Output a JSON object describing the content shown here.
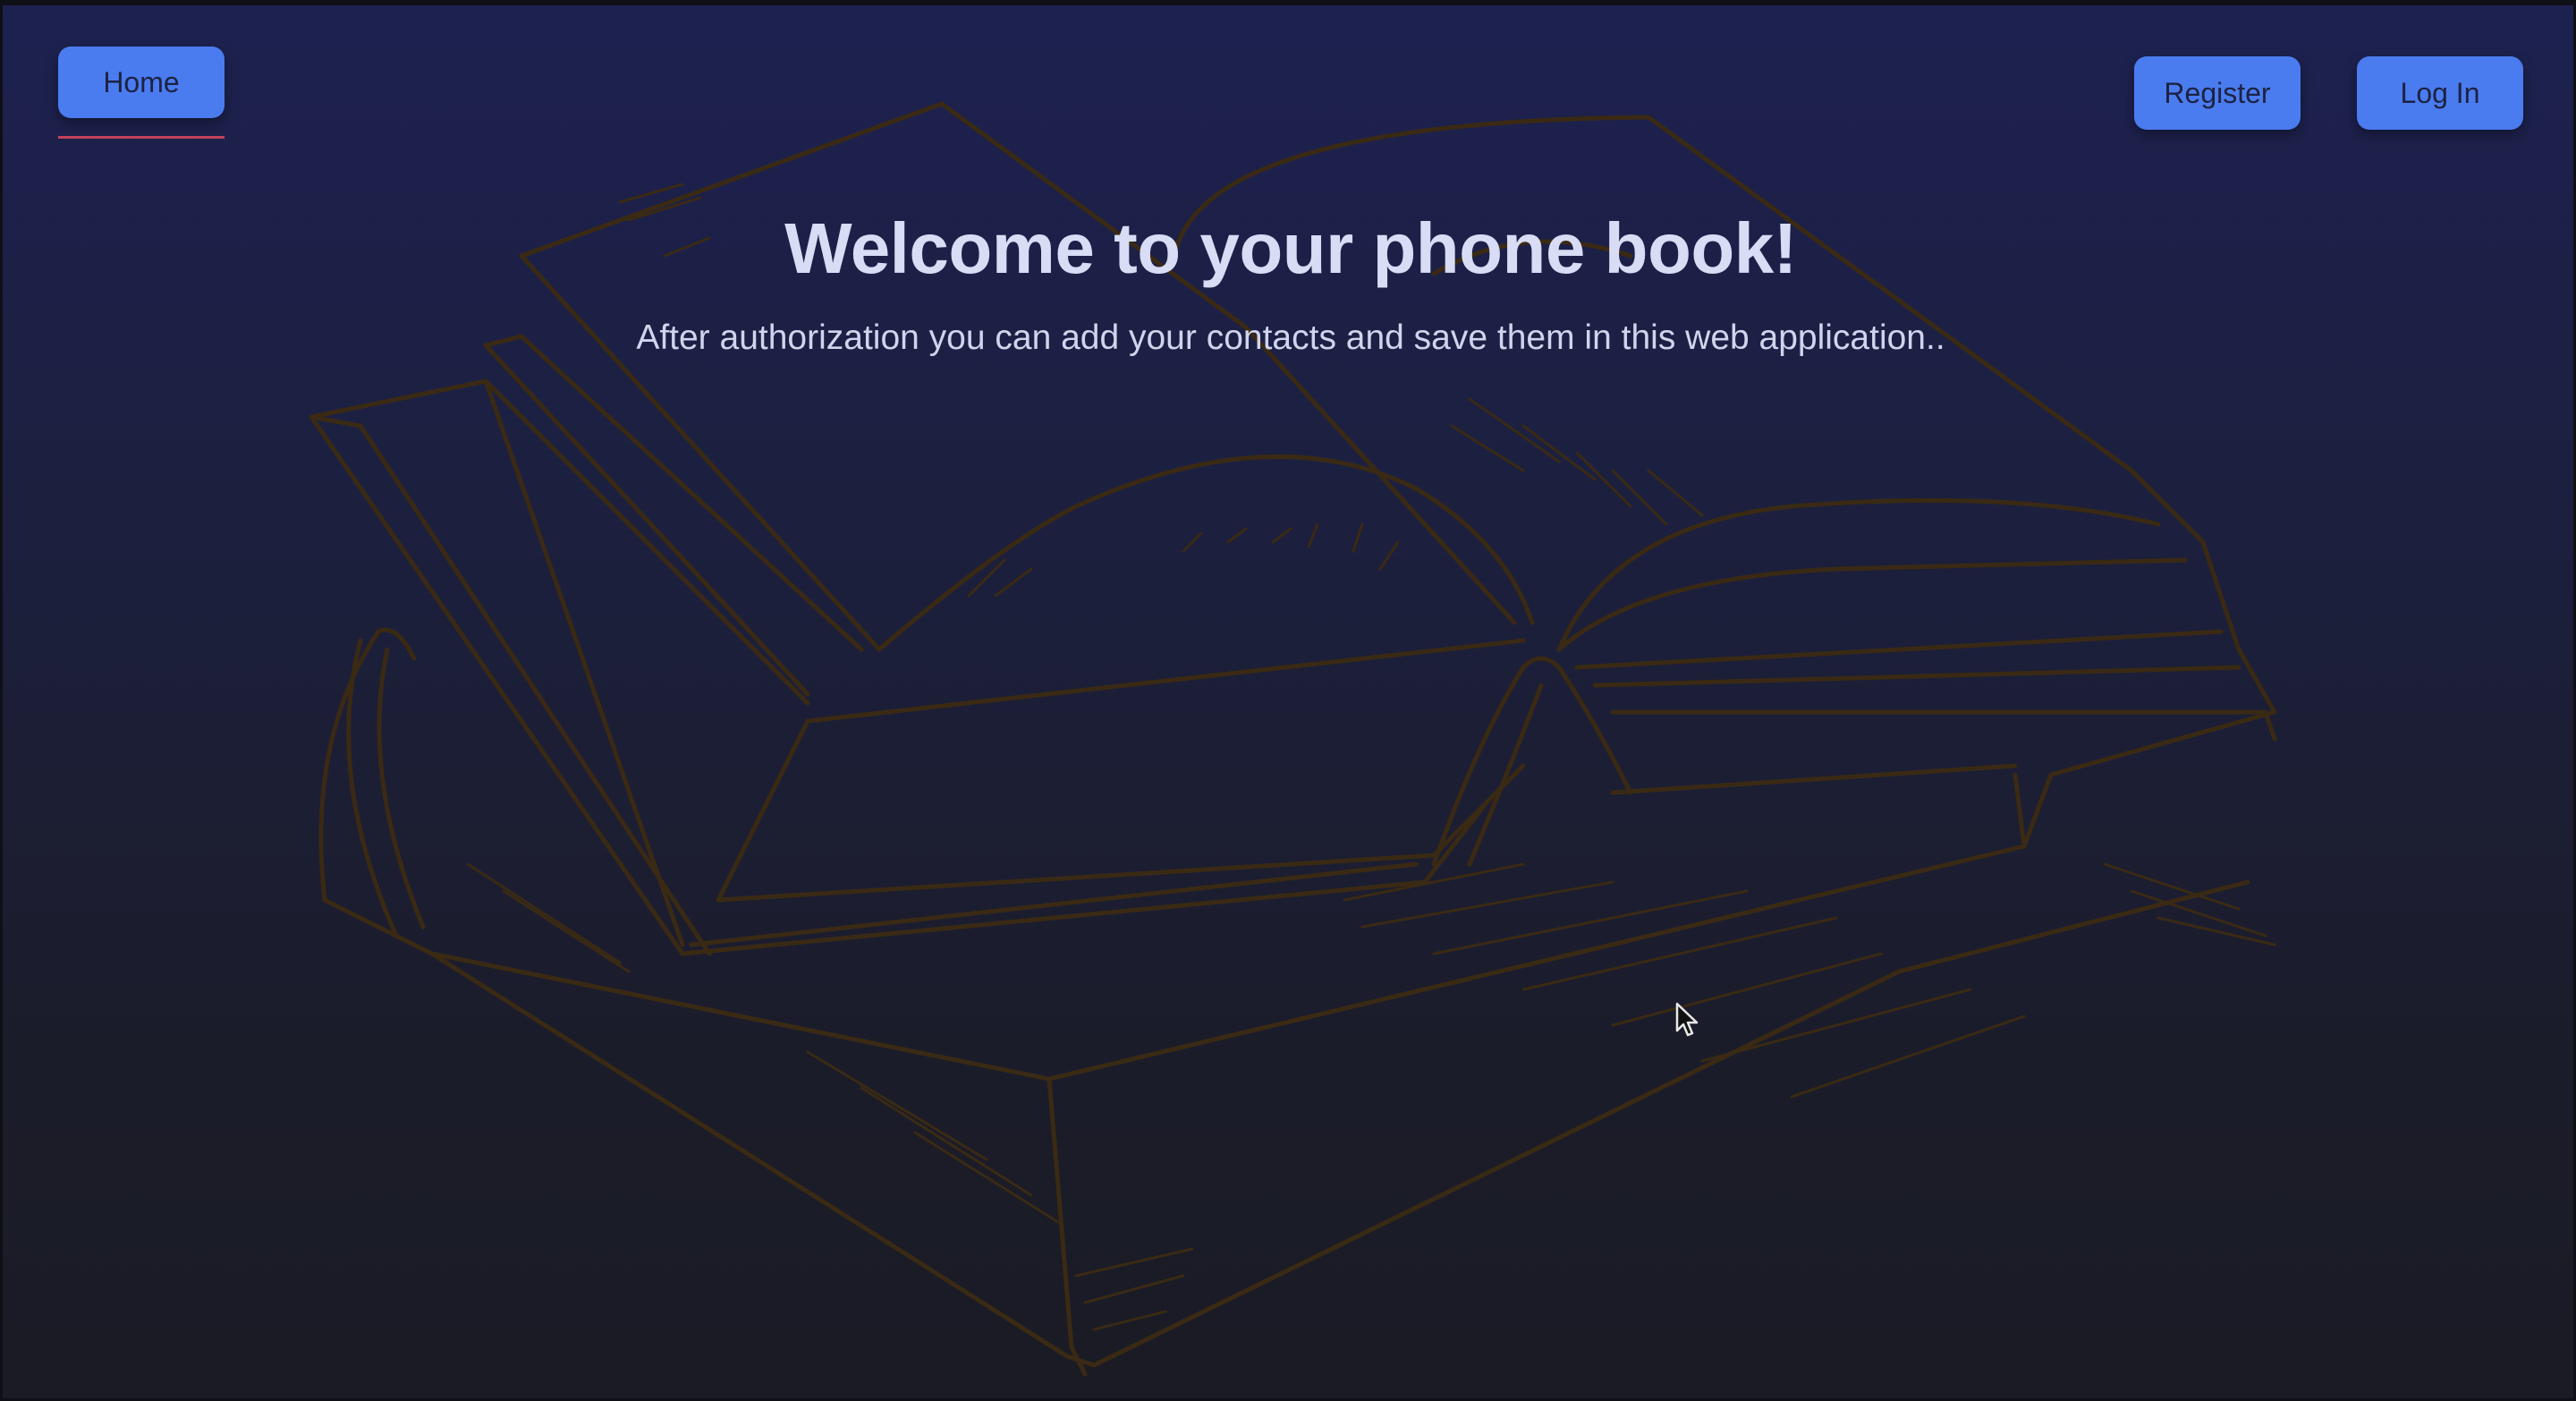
{
  "nav": {
    "home_label": "Home",
    "register_label": "Register",
    "login_label": "Log In"
  },
  "hero": {
    "title": "Welcome to your phone book!",
    "subtitle": "After authorization you can add your contacts and save them in this web application.."
  },
  "colors": {
    "button_bg": "#4a7cf0",
    "button_text": "#1d2240",
    "active_underline": "#c2415a",
    "title_text": "#d8dcf4",
    "background_top": "#1d2150",
    "background_bottom": "#1a1b24",
    "sketch_stroke": "#3a2a14"
  },
  "icons": {
    "background": "open-book-sketch",
    "pointer": "mouse-cursor"
  }
}
